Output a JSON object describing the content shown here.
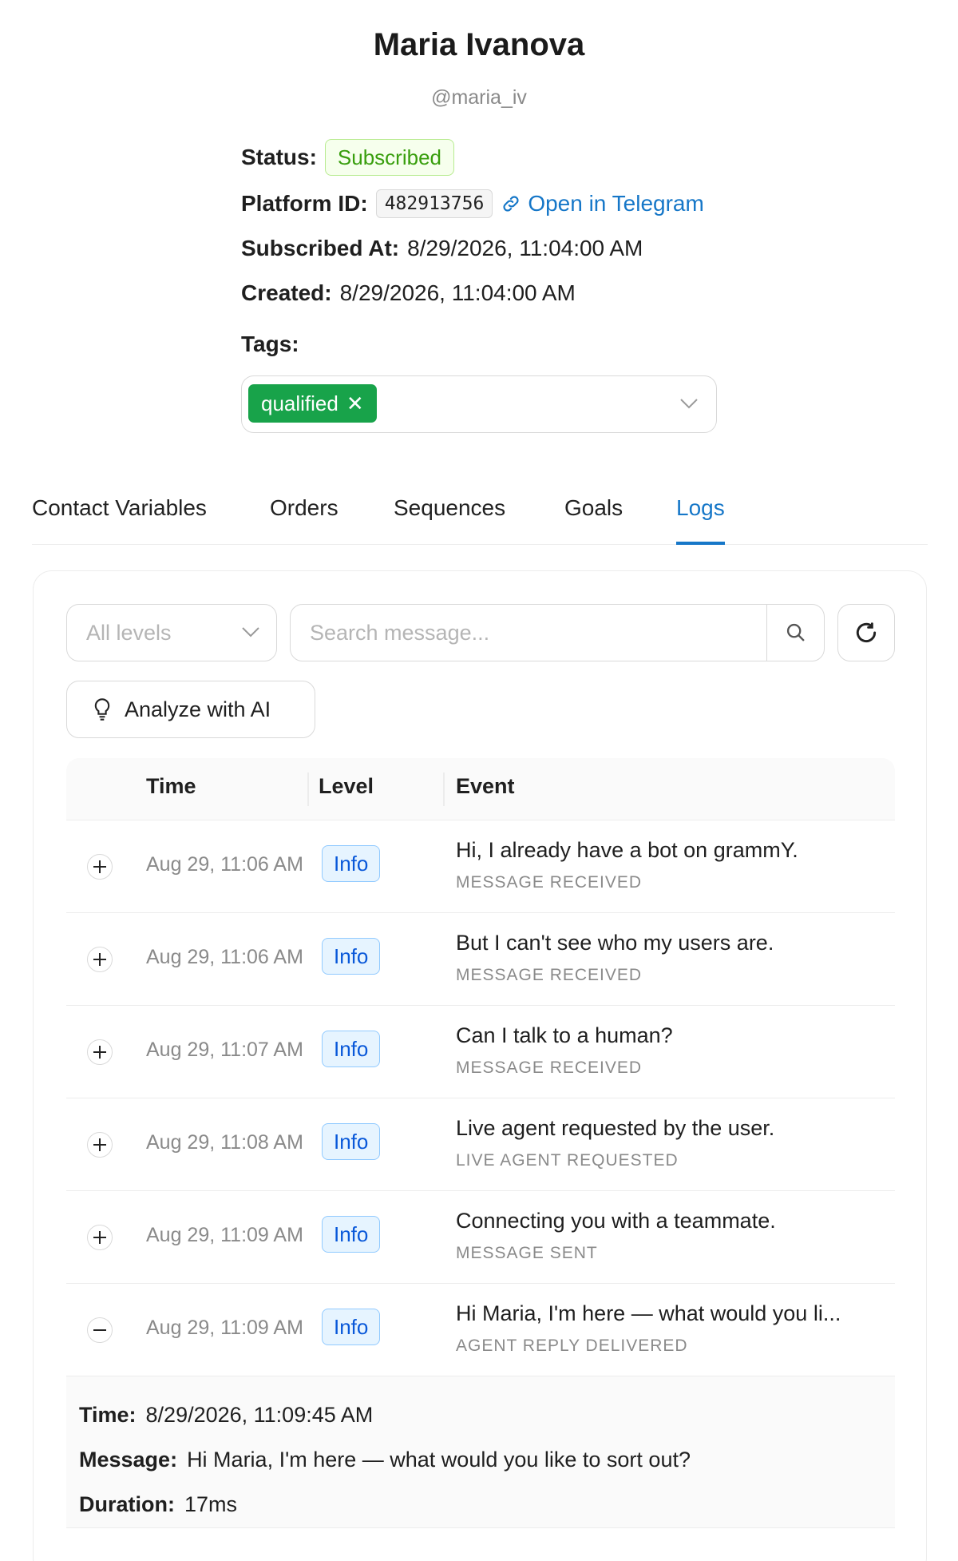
{
  "profile": {
    "name": "Maria Ivanova",
    "username": "@maria_iv",
    "status_label": "Status:",
    "status_value": "Subscribed",
    "platform_id_label": "Platform ID:",
    "platform_id": "482913756",
    "open_link": "Open in Telegram",
    "subscribed_at_label": "Subscribed At:",
    "subscribed_at": "8/29/2026, 11:04:00 AM",
    "created_label": "Created:",
    "created": "8/29/2026, 11:04:00 AM",
    "tags_label": "Tags:",
    "tags": [
      "qualified"
    ]
  },
  "tabs": [
    {
      "label": "Contact Variables"
    },
    {
      "label": "Orders"
    },
    {
      "label": "Sequences"
    },
    {
      "label": "Goals"
    },
    {
      "label": "Logs",
      "active": true
    }
  ],
  "logs": {
    "level_placeholder": "All levels",
    "search_placeholder": "Search message...",
    "analyze_label": "Analyze with AI",
    "columns": [
      "Time",
      "Level",
      "Event"
    ],
    "rows": [
      {
        "time": "Aug 29, 11:06 AM",
        "level": "Info",
        "message": "Hi, I already have a bot on grammY.",
        "event": "MESSAGE RECEIVED",
        "expanded": false
      },
      {
        "time": "Aug 29, 11:06 AM",
        "level": "Info",
        "message": "But I can't see who my users are.",
        "event": "MESSAGE RECEIVED",
        "expanded": false
      },
      {
        "time": "Aug 29, 11:07 AM",
        "level": "Info",
        "message": "Can I talk to a human?",
        "event": "MESSAGE RECEIVED",
        "expanded": false
      },
      {
        "time": "Aug 29, 11:08 AM",
        "level": "Info",
        "message": "Live agent requested by the user.",
        "event": "LIVE AGENT REQUESTED",
        "expanded": false
      },
      {
        "time": "Aug 29, 11:09 AM",
        "level": "Info",
        "message": "Connecting you with a teammate.",
        "event": "MESSAGE SENT",
        "expanded": false
      },
      {
        "time": "Aug 29, 11:09 AM",
        "level": "Info",
        "message": "Hi Maria, I'm here — what would you li...",
        "event": "AGENT REPLY DELIVERED",
        "expanded": true
      }
    ],
    "details": {
      "time_label": "Time:",
      "time": "8/29/2026, 11:09:45 AM",
      "message_label": "Message:",
      "message": "Hi Maria, I'm here — what would you like to sort out?",
      "duration_label": "Duration:",
      "duration": "17ms"
    }
  },
  "colors": {
    "accent": "#1677c8",
    "tag_bg": "#18a34a",
    "status_green": "#389e0d",
    "info_blue": "#0958d9"
  }
}
